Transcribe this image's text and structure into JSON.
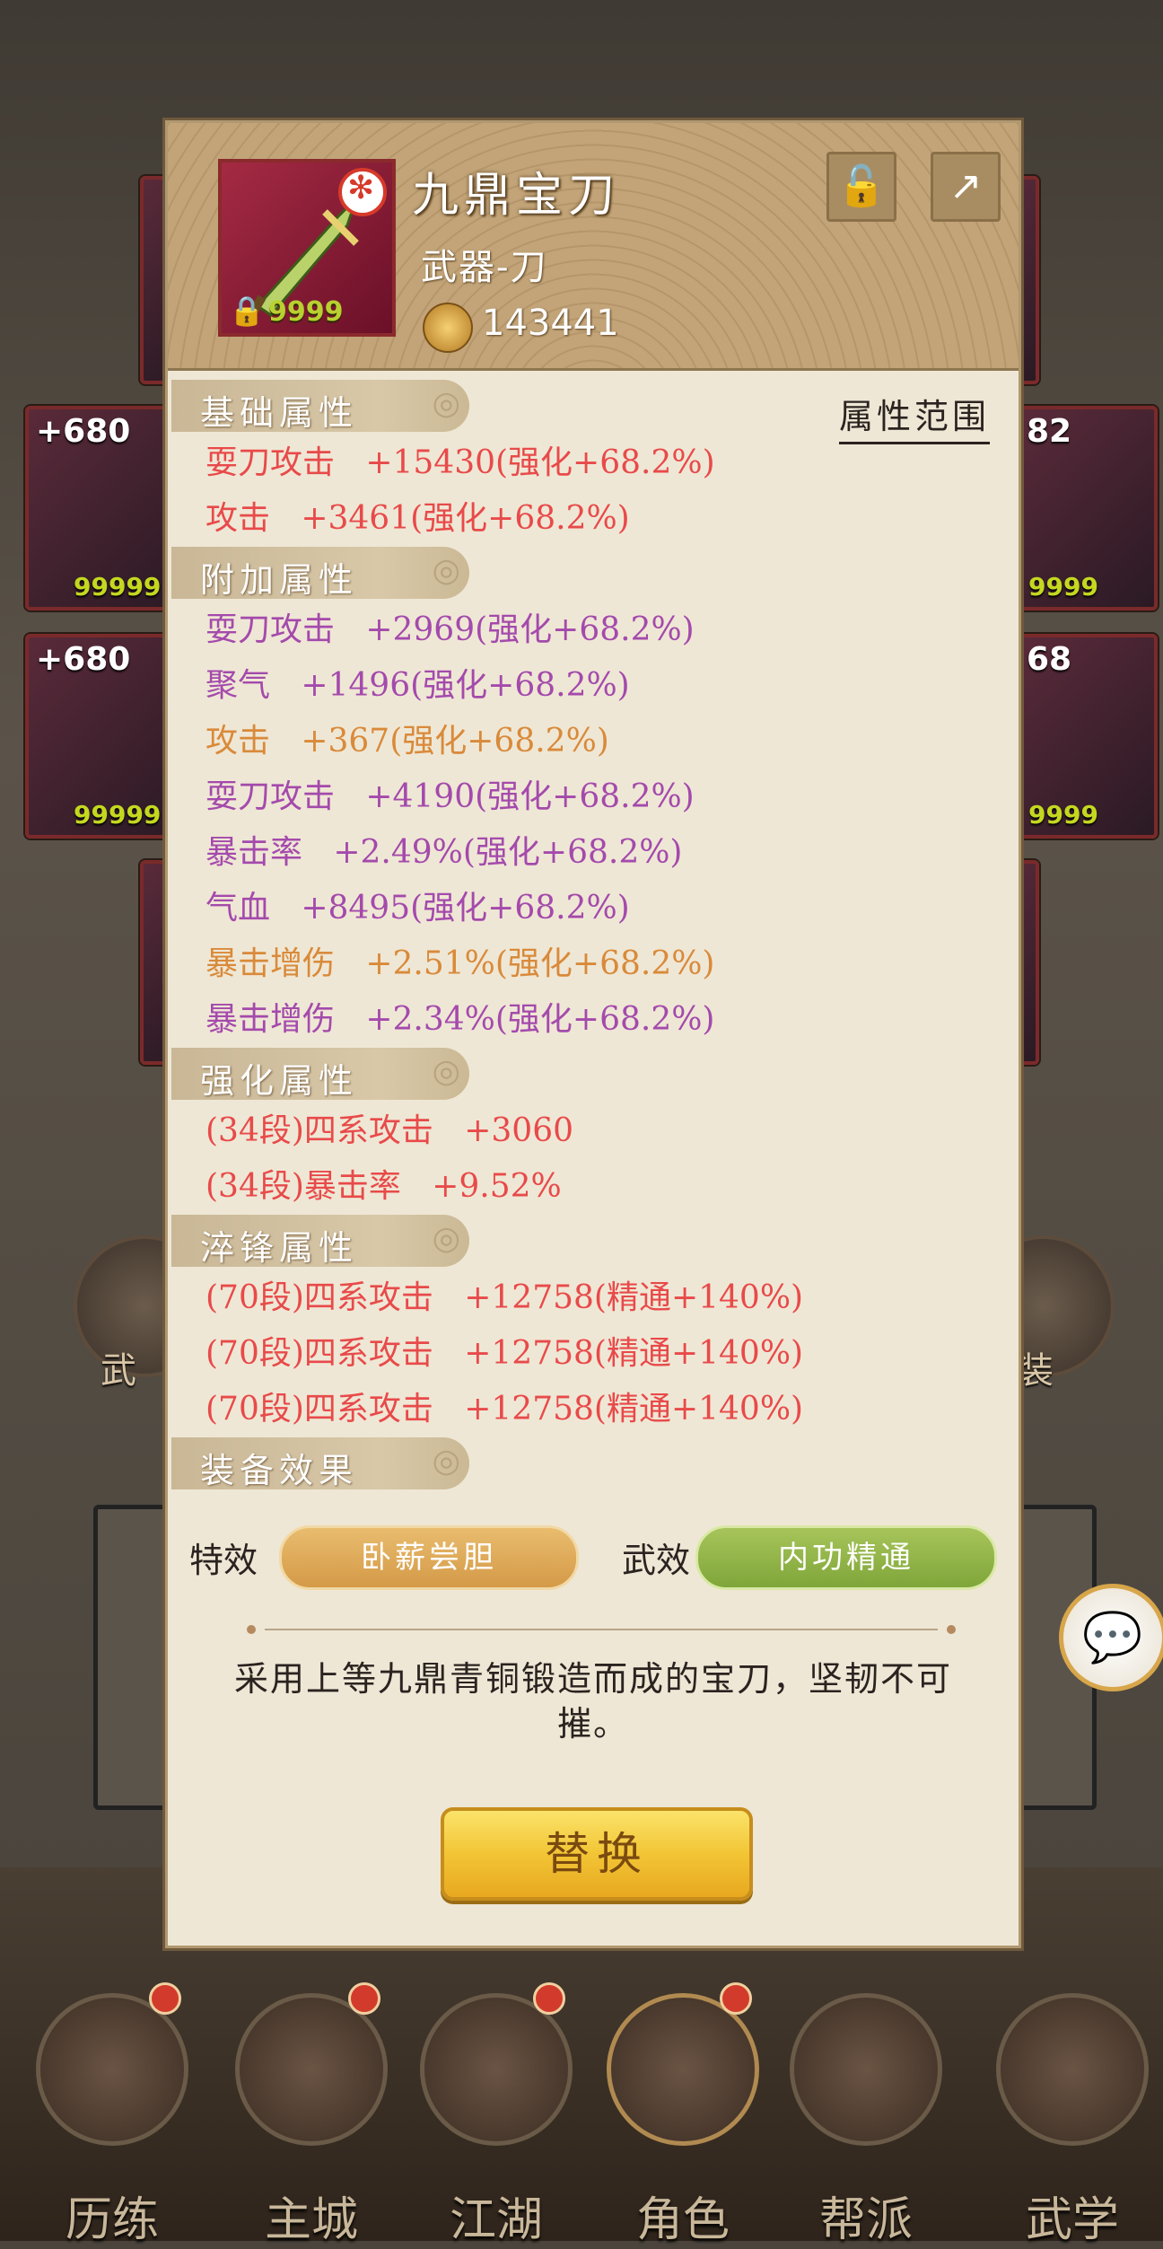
{
  "background": {
    "cards": [
      {
        "plus": "+680",
        "level": "99999"
      },
      {
        "plus": "+680",
        "level": "99999"
      },
      {
        "plus": "82",
        "level": "9999"
      },
      {
        "plus": "68",
        "level": "9999"
      }
    ],
    "side_left_label": "武",
    "side_right_label": "装"
  },
  "item": {
    "name": "九鼎宝刀",
    "type": "武器-刀",
    "icon_level": "9999",
    "power": "143441"
  },
  "range_link": "属性范围",
  "sections": {
    "base": {
      "title": "基础属性",
      "attrs": [
        {
          "text": "耍刀攻击   +15430(强化+68.2%)",
          "color": "red"
        },
        {
          "text": "攻击   +3461(强化+68.2%)",
          "color": "red"
        }
      ]
    },
    "extra": {
      "title": "附加属性",
      "attrs": [
        {
          "text": "耍刀攻击   +2969(强化+68.2%)",
          "color": "purple"
        },
        {
          "text": "聚气   +1496(强化+68.2%)",
          "color": "purple"
        },
        {
          "text": "攻击   +367(强化+68.2%)",
          "color": "orange"
        },
        {
          "text": "耍刀攻击   +4190(强化+68.2%)",
          "color": "purple"
        },
        {
          "text": "暴击率   +2.49%(强化+68.2%)",
          "color": "purple"
        },
        {
          "text": "气血   +8495(强化+68.2%)",
          "color": "purple"
        },
        {
          "text": "暴击增伤   +2.51%(强化+68.2%)",
          "color": "orange"
        },
        {
          "text": "暴击增伤   +2.34%(强化+68.2%)",
          "color": "purple"
        }
      ]
    },
    "enhance": {
      "title": "强化属性",
      "attrs": [
        {
          "text": "(34段)四系攻击   +3060",
          "color": "red"
        },
        {
          "text": "(34段)暴击率   +9.52%",
          "color": "red"
        }
      ]
    },
    "temper": {
      "title": "淬锋属性",
      "attrs": [
        {
          "text": "(70段)四系攻击   +12758(精通+140%)",
          "color": "red"
        },
        {
          "text": "(70段)四系攻击   +12758(精通+140%)",
          "color": "red"
        },
        {
          "text": "(70段)四系攻击   +12758(精通+140%)",
          "color": "red"
        }
      ]
    },
    "equip": {
      "title": "装备效果"
    }
  },
  "effects": {
    "special_label": "特效",
    "special_value": "卧薪尝胆",
    "martial_label": "武效",
    "martial_value": "内功精通"
  },
  "description": "采用上等九鼎青铜锻造而成的宝刀，坚韧不可摧。",
  "replace_button": "替换",
  "nav": [
    {
      "label": "历练"
    },
    {
      "label": "主城"
    },
    {
      "label": "江湖"
    },
    {
      "label": "角色"
    },
    {
      "label": "帮派"
    },
    {
      "label": "武学"
    }
  ],
  "colors": {
    "red": "#e84a4a",
    "purple": "#a44aac",
    "orange": "#d98a3a",
    "accent_gold": "#f2c535"
  }
}
